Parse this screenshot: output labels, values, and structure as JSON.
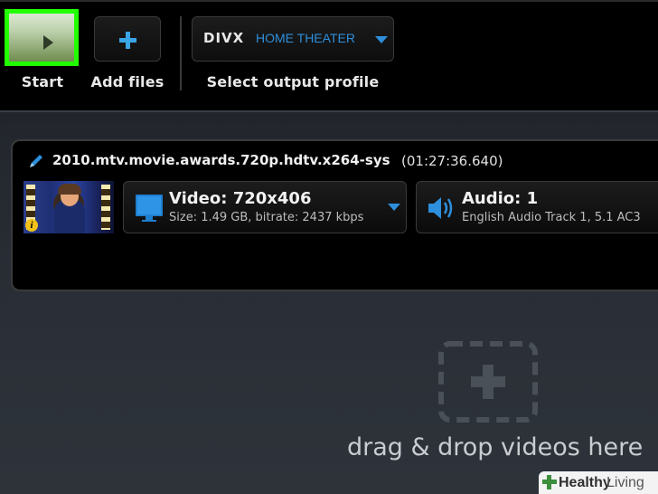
{
  "toolbar": {
    "start_label": "Start",
    "add_files_label": "Add files",
    "profile_brand": "DIVX",
    "profile_name": "HOME THEATER",
    "select_profile_label": "Select output profile"
  },
  "file": {
    "name": "2010.mtv.movie.awards.720p.hdtv.x264-sys",
    "duration": "(01:27:36.640)",
    "info_badge": "i",
    "video": {
      "title": "Video: 720x406",
      "details": "Size: 1.49 GB, bitrate: 2437 kbps"
    },
    "audio": {
      "title": "Audio: 1",
      "details": "English Audio Track 1, 5.1 AC3"
    }
  },
  "dropzone": {
    "text": "drag & drop videos here"
  },
  "watermark": {
    "brand": "Healthy",
    "brand2": "Living"
  },
  "colors": {
    "accent": "#2e8fdc",
    "start_highlight": "#22ff00"
  }
}
